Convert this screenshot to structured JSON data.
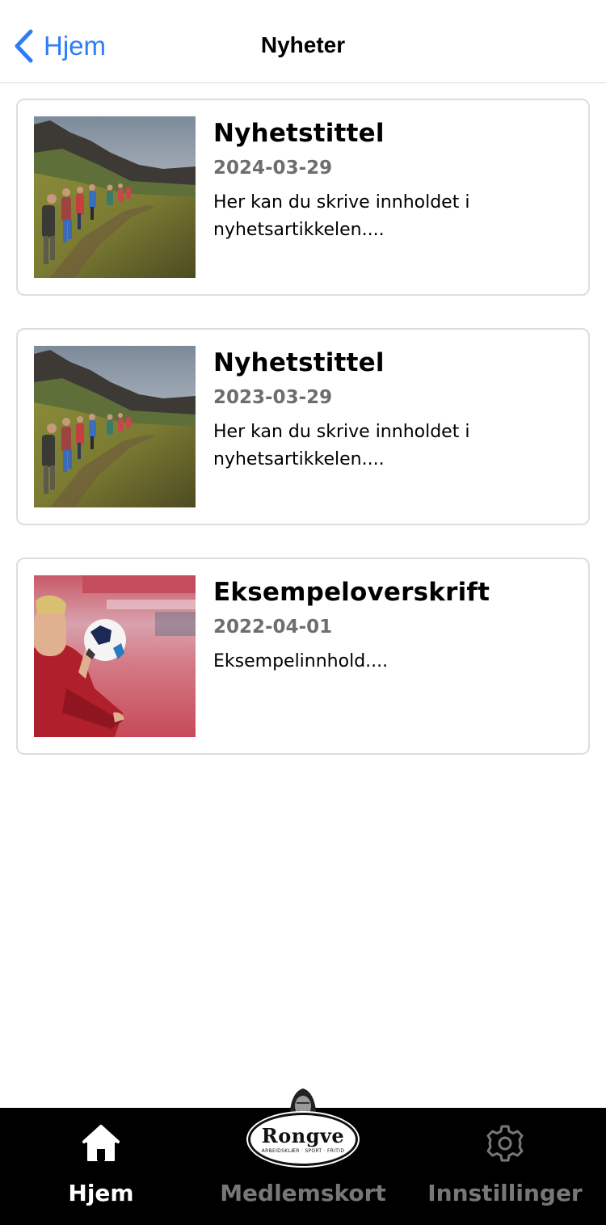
{
  "header": {
    "back_label": "Hjem",
    "title": "Nyheter"
  },
  "news": [
    {
      "title": "Nyhetstittel",
      "date": "2024-03-29",
      "body": "Her kan du skrive innholdet i nyhetsartikkelen....",
      "image": "hikers-on-mountain-trail"
    },
    {
      "title": "Nyhetstittel",
      "date": "2023-03-29",
      "body": "Her kan du skrive innholdet i nyhetsartikkelen....",
      "image": "hikers-on-mountain-trail"
    },
    {
      "title": "Eksempeloverskrift",
      "date": "2022-04-01",
      "body": "Eksempelinnhold....",
      "image": "football-player-holding-ball"
    }
  ],
  "tabbar": {
    "home_label": "Hjem",
    "card_label": "Medlemskort",
    "settings_label": "Innstillinger",
    "logo_text": "Rongve",
    "logo_subtext": "ARBEIDSKLÆR · SPORT · FRITID",
    "active_color": "#ffffff",
    "inactive_color": "#777777"
  },
  "colors": {
    "accent": "#2f7df6",
    "date_gray": "#6e6e6e",
    "tabbar_bg": "#000000"
  }
}
